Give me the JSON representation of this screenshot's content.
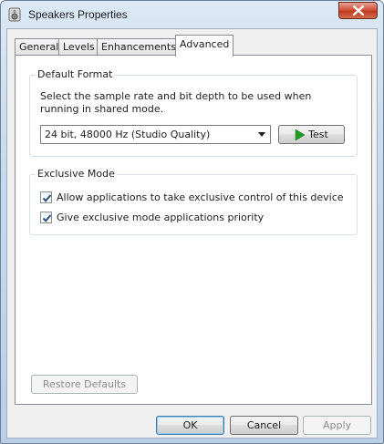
{
  "window": {
    "title": "Speakers Properties"
  },
  "tabs": [
    {
      "label": "General",
      "active": false
    },
    {
      "label": "Levels",
      "active": false
    },
    {
      "label": "Enhancements",
      "active": false
    },
    {
      "label": "Advanced",
      "active": true
    }
  ],
  "default_format": {
    "title": "Default Format",
    "description": "Select the sample rate and bit depth to be used when running in shared mode.",
    "selected_format": "24 bit, 48000 Hz (Studio Quality)",
    "test_label": "Test"
  },
  "exclusive_mode": {
    "title": "Exclusive Mode",
    "options": [
      {
        "label": "Allow applications to take exclusive control of this device",
        "checked": true
      },
      {
        "label": "Give exclusive mode applications priority",
        "checked": true
      }
    ]
  },
  "restore_defaults_label": "Restore Defaults",
  "footer": {
    "ok_label": "OK",
    "cancel_label": "Cancel",
    "apply_label": "Apply"
  },
  "colors": {
    "play_icon": "#1e9e23",
    "close_button": "#c13a21"
  }
}
